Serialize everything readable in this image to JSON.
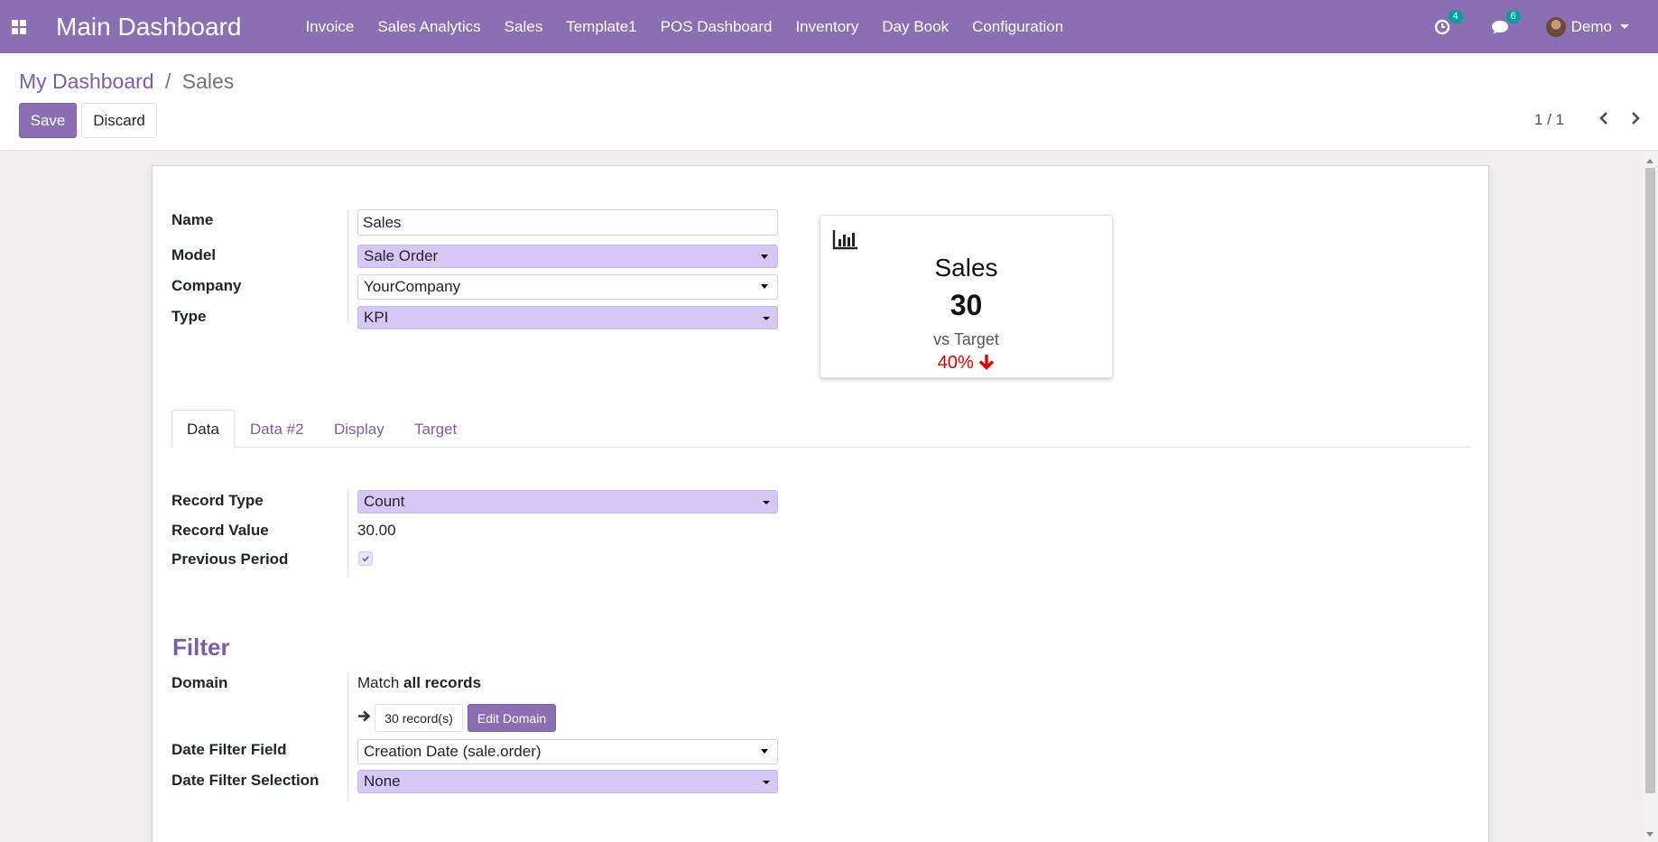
{
  "navbar": {
    "apps_icon": "grid-icon",
    "brand": "Main Dashboard",
    "menu": [
      "Invoice",
      "Sales Analytics",
      "Sales",
      "Template1",
      "POS Dashboard",
      "Inventory",
      "Day Book",
      "Configuration"
    ],
    "activity_count": "4",
    "messages_count": "6",
    "user": "Demo"
  },
  "breadcrumb": {
    "parent": "My Dashboard",
    "separator": "/",
    "current": "Sales"
  },
  "buttons": {
    "save": "Save",
    "discard": "Discard"
  },
  "pager": {
    "value": "1 / 1"
  },
  "form": {
    "name_label": "Name",
    "name_value": "Sales",
    "model_label": "Model",
    "model_value": "Sale Order",
    "company_label": "Company",
    "company_value": "YourCompany",
    "type_label": "Type",
    "type_value": "KPI"
  },
  "kpi": {
    "icon": "bar-chart-icon",
    "title": "Sales",
    "value": "30",
    "vs_label": "vs Target",
    "percent": "40%",
    "trend_icon": "arrow-down-icon",
    "trend_color": "#e00000"
  },
  "tabs": [
    "Data",
    "Data #2",
    "Display",
    "Target"
  ],
  "data_tab": {
    "record_type_label": "Record Type",
    "record_type_value": "Count",
    "record_value_label": "Record Value",
    "record_value": "30.00",
    "previous_period_label": "Previous Period",
    "previous_period_checked": true
  },
  "filter": {
    "title": "Filter",
    "domain_label": "Domain",
    "domain_match": "Match",
    "domain_scope": "all records",
    "records_button": "30 record(s)",
    "edit_domain_button": "Edit Domain",
    "date_field_label": "Date Filter Field",
    "date_field_value": "Creation Date (sale.order)",
    "date_selection_label": "Date Filter Selection",
    "date_selection_value": "None"
  },
  "colors": {
    "primary": "#8b6fb3",
    "link": "#7c5da8",
    "select_bg": "#d6c8f5",
    "badge": "#00a09d"
  }
}
